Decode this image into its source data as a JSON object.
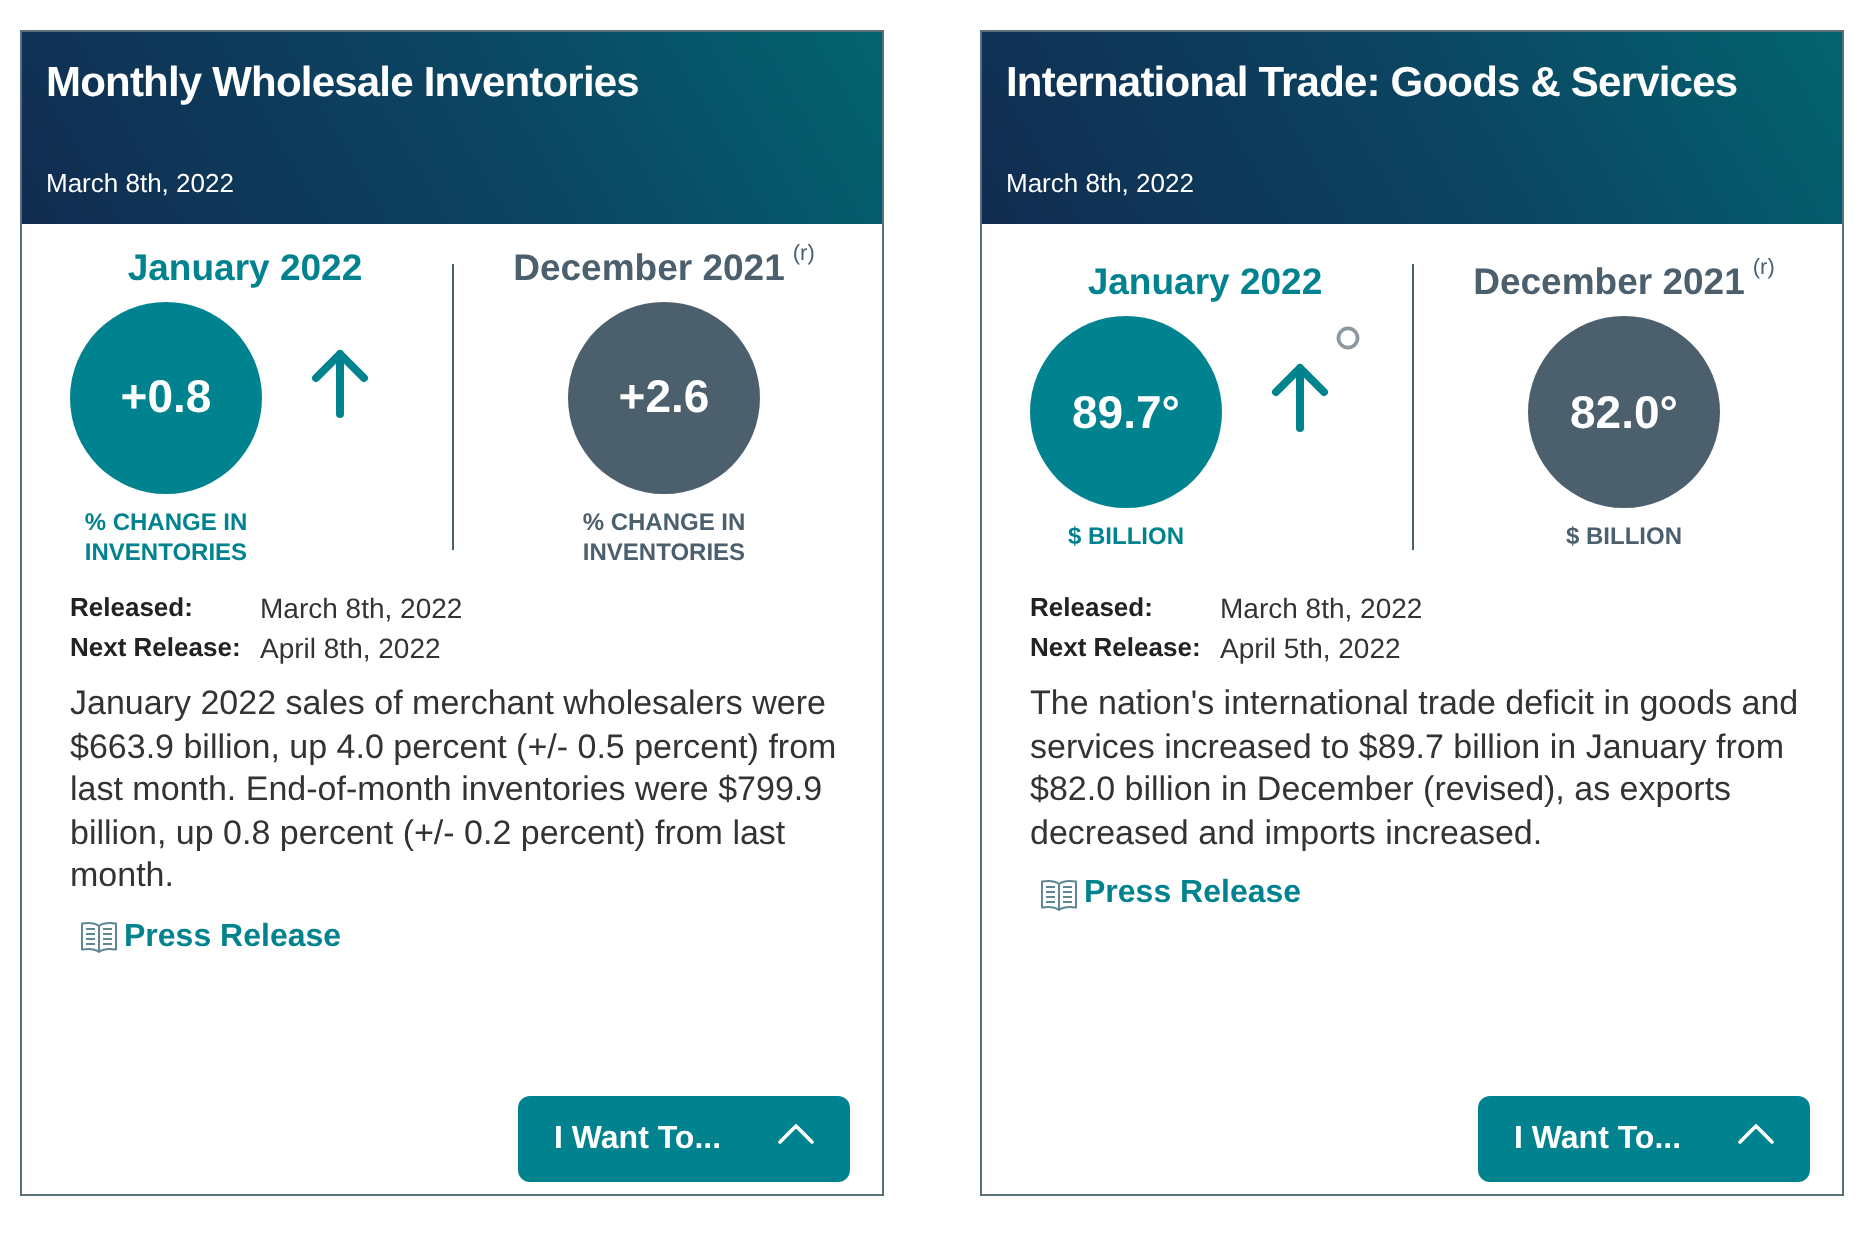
{
  "cards": [
    {
      "title": "Monthly Wholesale Inventories",
      "date": "March 8th, 2022",
      "current": {
        "period": "January 2022",
        "value": "+0.8",
        "unit": "% CHANGE IN INVENTORIES",
        "rising": true,
        "ring_marker": false
      },
      "previous": {
        "period": "December 2021",
        "note": "(r)",
        "value": "+2.6",
        "unit": "% CHANGE IN INVENTORIES"
      },
      "released": {
        "label": "Released:",
        "value": "March 8th, 2022"
      },
      "next_release": {
        "label": "Next Release:",
        "value": "April 8th, 2022"
      },
      "description": "January 2022 sales of merchant wholesalers were $663.9 billion, up 4.0 percent (+/- 0.5 percent) from last month. End-of-month inventories were $799.9 billion, up 0.8 percent (+/- 0.2 percent) from last month.",
      "link": "Press Release",
      "button": "I Want To..."
    },
    {
      "title": "International Trade: Goods & Services",
      "date": "March 8th, 2022",
      "current": {
        "period": "January 2022",
        "value": "89.7°",
        "unit": "$ BILLION",
        "rising": true,
        "ring_marker": true
      },
      "previous": {
        "period": "December 2021",
        "note": "(r)",
        "value": "82.0°",
        "unit": "$ BILLION"
      },
      "released": {
        "label": "Released:",
        "value": "March 8th, 2022"
      },
      "next_release": {
        "label": "Next Release:",
        "value": "April 5th, 2022"
      },
      "description": "The nation's international trade deficit in goods and services increased to $89.7 billion in January from $82.0 billion in December (revised), as exports decreased and imports increased.",
      "link": "Press Release",
      "button": "I Want To..."
    }
  ]
}
